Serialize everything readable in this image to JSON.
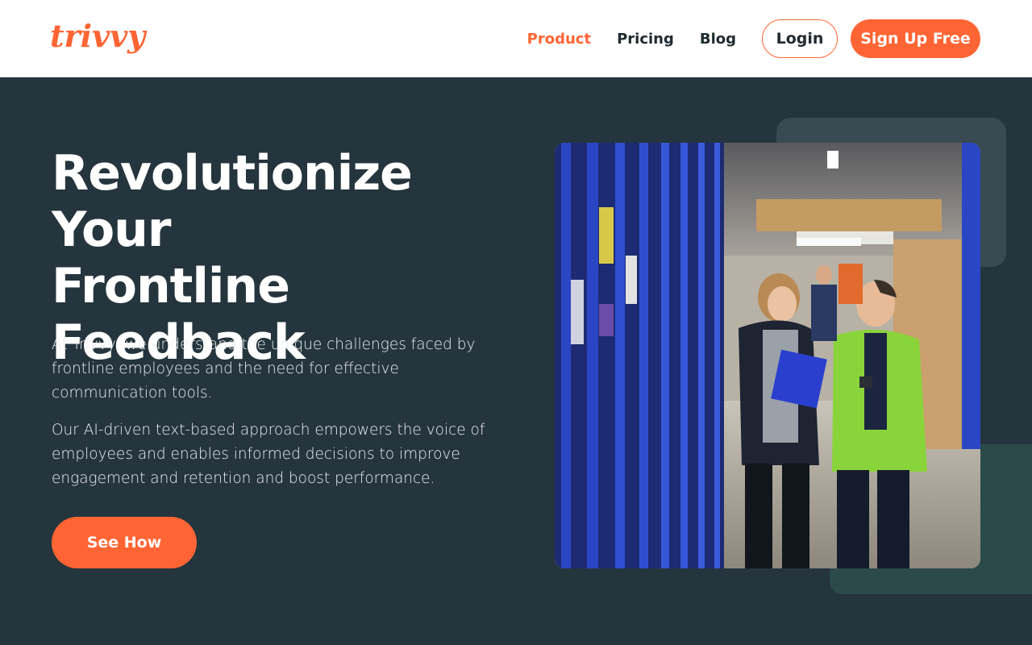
{
  "brand": {
    "logo_text": "trivvy",
    "accent_color": "#ff6534",
    "hero_bg": "#25353d"
  },
  "nav": {
    "links": [
      {
        "label": "Product",
        "active": true
      },
      {
        "label": "Pricing",
        "active": false
      },
      {
        "label": "Blog",
        "active": false
      }
    ],
    "login_label": "Login",
    "signup_label": "Sign Up Free"
  },
  "hero": {
    "title_lines": [
      "Revolutionize Your",
      "Frontline",
      "Feedback"
    ],
    "paragraph_1": "At Trivvy, we understand the unique challenges faced by frontline employees and the need for effective communication tools.",
    "paragraph_2": "Our AI-driven text-based approach empowers the voice of employees and enables informed decisions to improve engagement and retention and boost performance.",
    "cta_label": "See How"
  }
}
